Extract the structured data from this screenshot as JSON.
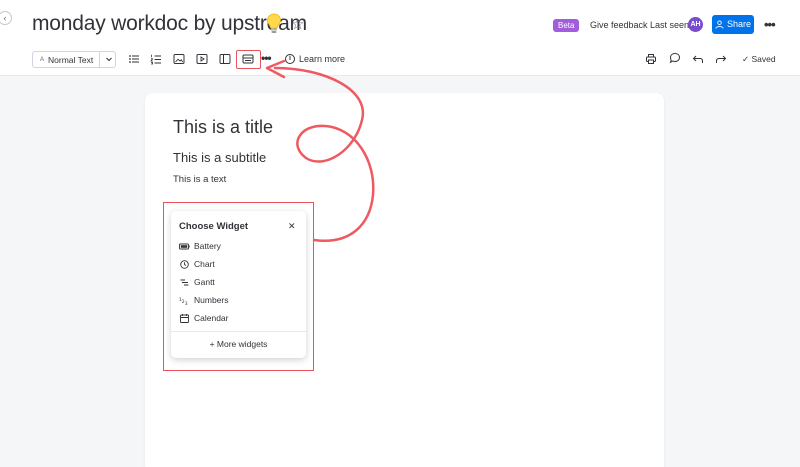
{
  "header": {
    "title": "monday workdoc by upstream",
    "beta_badge": "Beta",
    "feedback_label": "Give feedback",
    "last_seen_label": "Last seen",
    "avatar_initials": "AH",
    "share_label": "Share",
    "more_label": "•••"
  },
  "toolbar": {
    "text_style_prefix": "A",
    "text_style": "Normal Text",
    "learn_more": "Learn more",
    "saved": "✓ Saved",
    "more_label": "•••",
    "icons": [
      "bulleted-list-icon",
      "numbered-list-icon",
      "image-icon",
      "video-icon",
      "layout-icon",
      "widget-icon",
      "print-icon",
      "comment-icon",
      "undo-icon",
      "redo-icon"
    ]
  },
  "document": {
    "title": "This is a title",
    "subtitle": "This is a subtitle",
    "text": "This is a text"
  },
  "widget_picker": {
    "title": "Choose Widget",
    "close": "✕",
    "items": [
      {
        "label": "Battery",
        "icon": "battery-icon"
      },
      {
        "label": "Chart",
        "icon": "clock-chart-icon"
      },
      {
        "label": "Gantt",
        "icon": "gantt-icon"
      },
      {
        "label": "Numbers",
        "icon": "numbers-icon"
      },
      {
        "label": "Calendar",
        "icon": "calendar-icon"
      }
    ],
    "more_widgets": "+ More widgets"
  },
  "colors": {
    "accent": "#0073ea",
    "beta": "#a25ddc",
    "avatar": "#784bd1",
    "annotation": "#e8535a"
  }
}
